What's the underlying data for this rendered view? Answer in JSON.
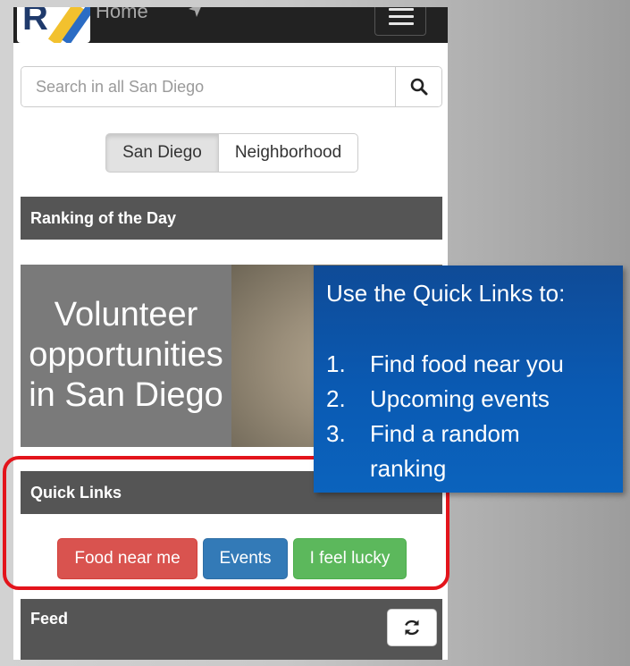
{
  "navbar": {
    "logo_icon": "rankings-logo",
    "home_label": "Home",
    "location_icon": "location-arrow-icon",
    "menu_icon": "hamburger-menu-icon"
  },
  "search": {
    "placeholder": "Search in all San Diego",
    "button_icon": "search-icon"
  },
  "scope_toggle": {
    "options": [
      "San Diego",
      "Neighborhood"
    ],
    "selected": "San Diego"
  },
  "ranking_of_day": {
    "heading": "Ranking of the Day",
    "banner_lines": [
      "Volunteer",
      "opportunities",
      "in San Diego"
    ]
  },
  "quick_links": {
    "heading": "Quick Links",
    "buttons": [
      {
        "label": "Food near me",
        "color": "#d9534f"
      },
      {
        "label": "Events",
        "color": "#337ab7"
      },
      {
        "label": "I feel lucky",
        "color": "#5cb85c"
      }
    ]
  },
  "feed": {
    "heading": "Feed",
    "refresh_icon": "refresh-icon"
  },
  "callout": {
    "title": "Use the Quick Links to:",
    "items": [
      {
        "num": "1.",
        "text": "Find food near you"
      },
      {
        "num": "2.",
        "text": "Upcoming events"
      },
      {
        "num": "3.",
        "text": "Find a random"
      },
      {
        "num": "",
        "text": "ranking"
      }
    ]
  },
  "colors": {
    "highlight": "#e3141b",
    "callout_bg": "#0b5aae",
    "panel_heading": "#555555"
  }
}
